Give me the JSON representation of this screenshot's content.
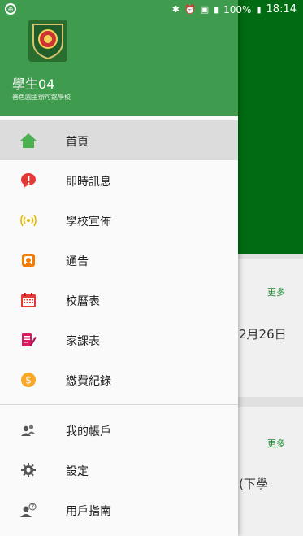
{
  "status_bar": {
    "battery_percent": "100%",
    "time": "18:14"
  },
  "user": {
    "name": "學生04",
    "school": "善色園主辦可銘學校"
  },
  "menu": {
    "primary": [
      {
        "label": "首頁",
        "icon": "home-icon"
      },
      {
        "label": "即時訊息",
        "icon": "message-alert-icon"
      },
      {
        "label": "學校宣佈",
        "icon": "broadcast-icon"
      },
      {
        "label": "通告",
        "icon": "notice-icon"
      },
      {
        "label": "校曆表",
        "icon": "calendar-icon"
      },
      {
        "label": "家課表",
        "icon": "homework-icon"
      },
      {
        "label": "繳費紀錄",
        "icon": "dollar-icon"
      }
    ],
    "secondary": [
      {
        "label": "我的帳戶",
        "icon": "account-icon"
      },
      {
        "label": "設定",
        "icon": "gear-icon"
      },
      {
        "label": "用戶指南",
        "icon": "user-guide-icon"
      }
    ]
  },
  "background": {
    "more1": "更多",
    "date_fragment": "2月26日",
    "more2": "更多",
    "text_fragment": "(下學"
  },
  "colors": {
    "header_green": "#3f9b4d",
    "app_green": "#006b12"
  }
}
